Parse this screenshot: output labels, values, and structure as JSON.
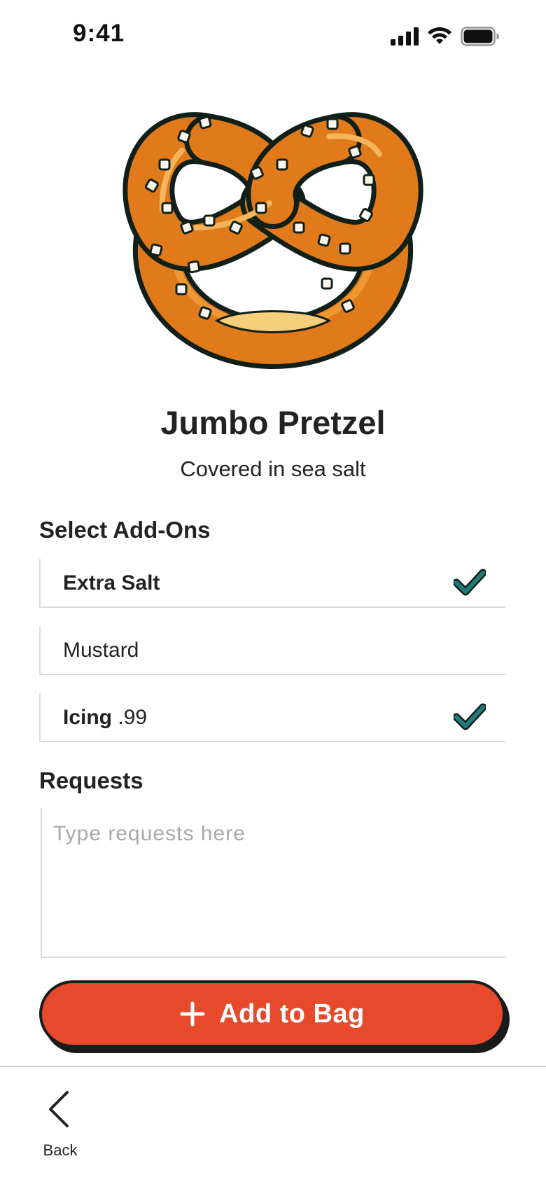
{
  "status_bar": {
    "time": "9:41",
    "icons": [
      "cellular-signal-icon",
      "wifi-icon",
      "battery-icon"
    ]
  },
  "product": {
    "image": "pretzel-illustration",
    "title": "Jumbo Pretzel",
    "subtitle": "Covered in sea salt"
  },
  "addons": {
    "heading": "Select Add-Ons",
    "items": [
      {
        "name": "Extra Salt",
        "price": "",
        "selected": true
      },
      {
        "name": "Mustard",
        "price": "",
        "selected": false
      },
      {
        "name": "Icing",
        "price": ".99",
        "selected": true
      }
    ]
  },
  "requests": {
    "heading": "Requests",
    "value": "",
    "placeholder": "Type requests here"
  },
  "add_button": {
    "icon": "plus-icon",
    "label": "Add to Bag"
  },
  "nav": {
    "back_icon": "chevron-left-icon",
    "back_label": "Back"
  },
  "colors": {
    "accent": "#e64a2b",
    "check": "#1f7a7a",
    "outline": "#1b1b1b",
    "pretzel": "#e07a1a"
  }
}
